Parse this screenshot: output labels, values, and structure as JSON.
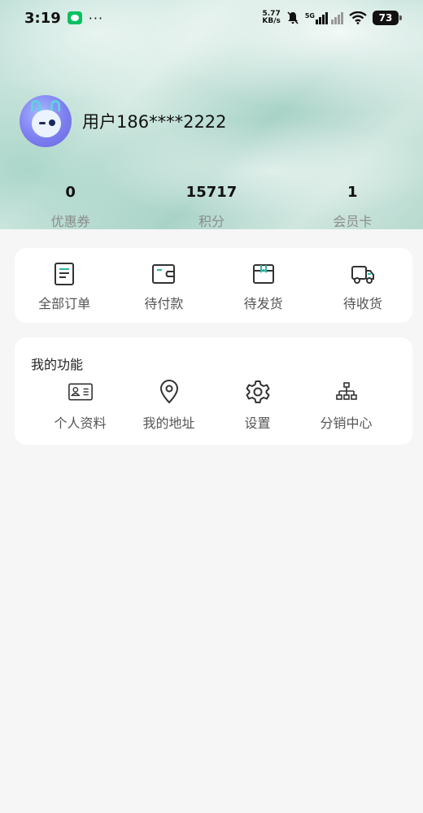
{
  "status_bar": {
    "time": "3:19",
    "net_speed_value": "5.77",
    "net_speed_unit": "KB/s",
    "signal": "5G",
    "battery": "73",
    "icons": [
      "wechat-icon",
      "more-icon",
      "mute-bell-icon",
      "signal-icon",
      "wifi-icon",
      "battery-icon"
    ]
  },
  "profile": {
    "name": "用户186****2222"
  },
  "stats": [
    {
      "value": "0",
      "label": "优惠券"
    },
    {
      "value": "15717",
      "label": "积分"
    },
    {
      "value": "1",
      "label": "会员卡"
    }
  ],
  "orders": [
    {
      "label": "全部订单",
      "icon": "document-icon"
    },
    {
      "label": "待付款",
      "icon": "wallet-icon"
    },
    {
      "label": "待发货",
      "icon": "box-icon"
    },
    {
      "label": "待收货",
      "icon": "truck-icon"
    }
  ],
  "features": {
    "title": "我的功能",
    "items": [
      {
        "label": "个人资料",
        "icon": "id-card-icon"
      },
      {
        "label": "我的地址",
        "icon": "location-pin-icon"
      },
      {
        "label": "设置",
        "icon": "gear-icon"
      },
      {
        "label": "分销中心",
        "icon": "org-chart-icon"
      }
    ]
  },
  "colors": {
    "accent": "#2bb6a3",
    "icon_stroke": "#333333",
    "page_bg": "#f6f6f6"
  }
}
